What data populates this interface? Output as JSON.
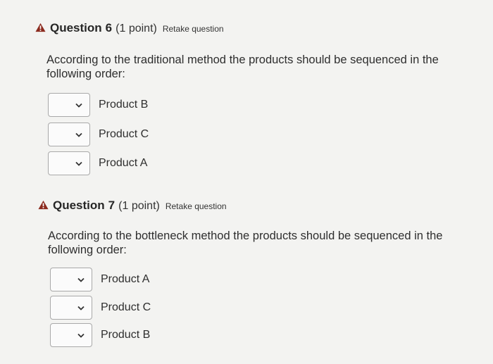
{
  "questions": [
    {
      "title": "Question",
      "number": "6",
      "points": "(1 point)",
      "retake": "Retake question",
      "text": "According to the traditional method the products should be sequenced in the following order:",
      "options": [
        {
          "selected": "",
          "label": "Product B"
        },
        {
          "selected": "",
          "label": "Product C"
        },
        {
          "selected": "",
          "label": "Product A"
        }
      ]
    },
    {
      "title": "Question",
      "number": "7",
      "points": "(1 point)",
      "retake": "Retake question",
      "text": "According to the bottleneck method the products should be sequenced in the following order:",
      "options": [
        {
          "selected": "",
          "label": "Product A"
        },
        {
          "selected": "",
          "label": "Product C"
        },
        {
          "selected": "",
          "label": "Product B"
        }
      ]
    }
  ],
  "colors": {
    "warning_icon": "#8b2a1e",
    "background": "#f3f3f1",
    "select_border": "#a9a9a9"
  },
  "icons": {
    "warning": "warning-triangle-icon",
    "chevron": "chevron-down-icon"
  }
}
